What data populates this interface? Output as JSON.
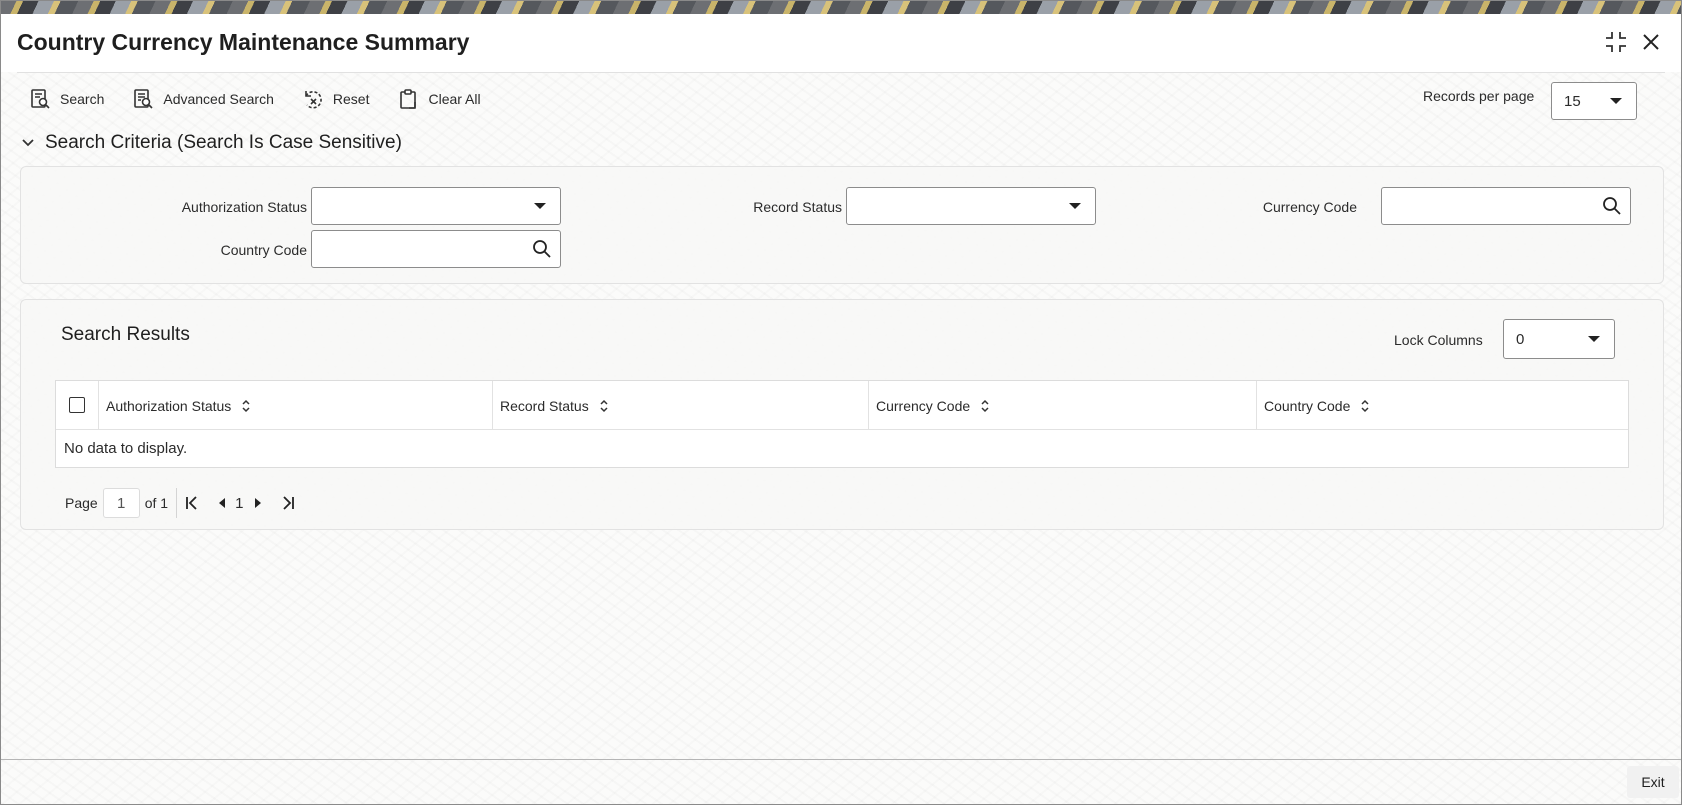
{
  "window": {
    "title": "Country Currency Maintenance Summary"
  },
  "toolbar": {
    "search_label": "Search",
    "advanced_search_label": "Advanced Search",
    "reset_label": "Reset",
    "clear_all_label": "Clear All",
    "records_per_page_label": "Records per page",
    "records_per_page_value": "15"
  },
  "criteria": {
    "title": "Search Criteria (Search Is Case Sensitive)",
    "authorization_status_label": "Authorization Status",
    "authorization_status_value": "",
    "record_status_label": "Record Status",
    "record_status_value": "",
    "currency_code_label": "Currency Code",
    "currency_code_value": "",
    "country_code_label": "Country Code",
    "country_code_value": ""
  },
  "results": {
    "title": "Search Results",
    "lock_columns_label": "Lock Columns",
    "lock_columns_value": "0",
    "columns": [
      "Authorization Status",
      "Record Status",
      "Currency Code",
      "Country Code"
    ],
    "empty_message": "No data to display."
  },
  "pager": {
    "page_label": "Page",
    "current_page": "1",
    "of_label": "of 1",
    "page_number": "1"
  },
  "footer": {
    "exit_label": "Exit"
  },
  "icons": {
    "collapse": "collapse-icon",
    "close": "close-icon",
    "search": "search-doc-icon",
    "advanced_search": "advanced-search-icon",
    "reset": "reset-icon",
    "clear_all": "clipboard-icon",
    "lookup": "magnifier-icon",
    "sort": "sort-icon"
  }
}
